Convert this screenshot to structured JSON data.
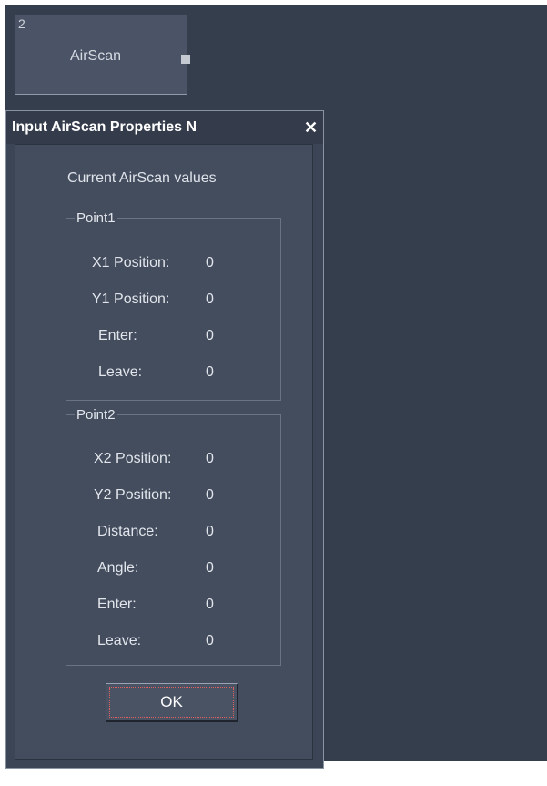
{
  "node": {
    "index": "2",
    "title": "AirScan"
  },
  "dialog": {
    "title": "Input AirScan Properties N",
    "close_icon": "close-icon",
    "subtitle": "Current AirScan values",
    "point1": {
      "label": "Point1",
      "fields": [
        {
          "label": "X1 Position:",
          "value": "0"
        },
        {
          "label": "Y1 Position:",
          "value": "0"
        },
        {
          "label": "Enter:",
          "value": "0"
        },
        {
          "label": "Leave:",
          "value": "0"
        }
      ]
    },
    "point2": {
      "label": "Point2",
      "fields": [
        {
          "label": "X2 Position:",
          "value": "0"
        },
        {
          "label": "Y2 Position:",
          "value": "0"
        },
        {
          "label": "Distance:",
          "value": "0"
        },
        {
          "label": "Angle:",
          "value": "0"
        },
        {
          "label": "Enter:",
          "value": "0"
        },
        {
          "label": "Leave:",
          "value": "0"
        }
      ]
    },
    "ok_label": "OK"
  },
  "colors": {
    "workspace": "#353e4d",
    "dialog_bg": "#444d5e",
    "text": "#e2e6ec"
  }
}
